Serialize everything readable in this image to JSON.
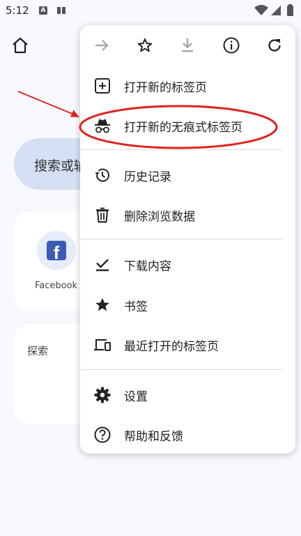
{
  "status_bar": {
    "time": "5:12",
    "notification_icons": [
      "a-letter-icon",
      "book-icon"
    ],
    "system_icons": [
      "wifi-icon",
      "signal-icon",
      "battery-icon"
    ]
  },
  "background": {
    "search_text": "搜索或输",
    "shortcut": {
      "label": "Facebook",
      "icon": "facebook-logo"
    },
    "explore_label": "探索"
  },
  "menu": {
    "toolbar": [
      "forward-icon",
      "star-outline-icon",
      "download-icon",
      "info-icon",
      "refresh-icon"
    ],
    "items": [
      {
        "label": "打开新的标签页",
        "icon": "new-tab-icon"
      },
      {
        "label": "打开新的无痕式标签页",
        "icon": "incognito-icon"
      },
      {
        "label": "历史记录",
        "icon": "history-icon"
      },
      {
        "label": "删除浏览数据",
        "icon": "trash-icon"
      },
      {
        "label": "下载内容",
        "icon": "downloads-icon"
      },
      {
        "label": "书签",
        "icon": "bookmark-star-icon"
      },
      {
        "label": "最近打开的标签页",
        "icon": "devices-icon"
      },
      {
        "label": "设置",
        "icon": "settings-gear-icon"
      },
      {
        "label": "帮助和反馈",
        "icon": "help-icon"
      }
    ]
  },
  "annotation": {
    "color": "#e0201e"
  }
}
